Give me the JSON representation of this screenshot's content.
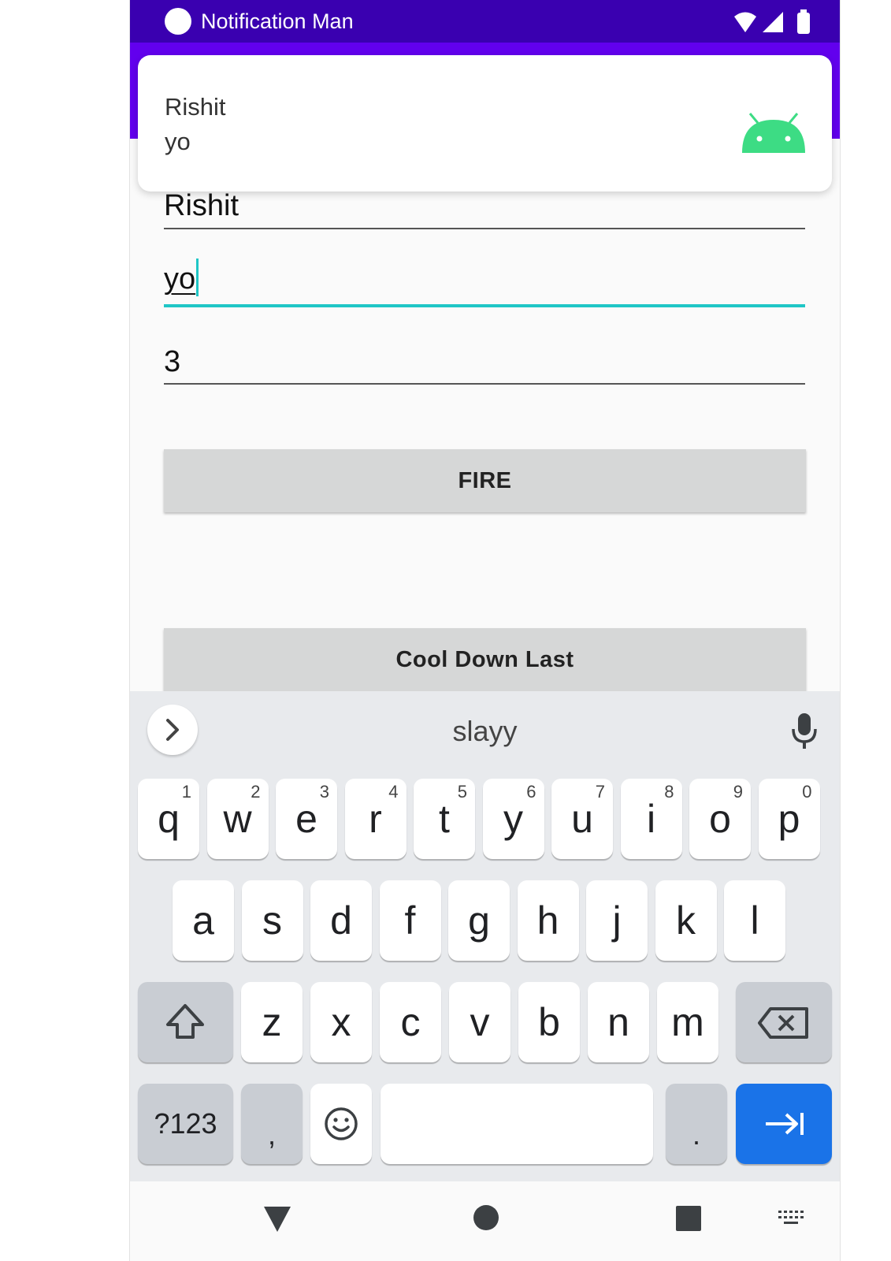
{
  "status_bar": {
    "title": "Notification Man"
  },
  "notification": {
    "title": "Rishit",
    "text": "yo"
  },
  "form": {
    "title_value": "Rishit",
    "message_value": "yo",
    "count_value": "3"
  },
  "buttons": {
    "fire": "FIRE",
    "cool_down": "Cool Down Last"
  },
  "keyboard": {
    "suggestion": "slayy",
    "row1": [
      {
        "k": "q",
        "h": "1"
      },
      {
        "k": "w",
        "h": "2"
      },
      {
        "k": "e",
        "h": "3"
      },
      {
        "k": "r",
        "h": "4"
      },
      {
        "k": "t",
        "h": "5"
      },
      {
        "k": "y",
        "h": "6"
      },
      {
        "k": "u",
        "h": "7"
      },
      {
        "k": "i",
        "h": "8"
      },
      {
        "k": "o",
        "h": "9"
      },
      {
        "k": "p",
        "h": "0"
      }
    ],
    "row2": [
      "a",
      "s",
      "d",
      "f",
      "g",
      "h",
      "j",
      "k",
      "l"
    ],
    "row3": [
      "z",
      "x",
      "c",
      "v",
      "b",
      "n",
      "m"
    ],
    "symbols_label": "?123",
    "comma": ",",
    "period": "."
  },
  "colors": {
    "status_bar": "#3a00b0",
    "toolbar": "#6200ee",
    "focus_accent": "#1fc6c6",
    "android_icon": "#3ddc84",
    "action_key": "#1a73e8"
  }
}
